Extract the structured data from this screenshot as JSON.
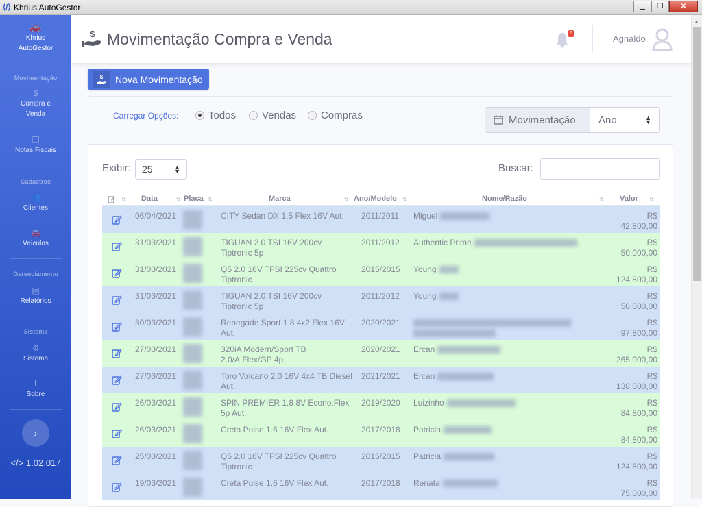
{
  "window": {
    "title": "Khrius AutoGestor",
    "minimize": "▁",
    "maximize": "❐",
    "close": "✕"
  },
  "sidebar": {
    "brand": "Khrius AutoGestor",
    "sections": {
      "movimentacao": "Movimentação",
      "cadastros": "Cadastros",
      "gerenciamento": "Gerenciamento",
      "sistema": "Sistema"
    },
    "items": {
      "compra_venda": "Compra e Venda",
      "notas": "Notas Fiscais",
      "clientes": "Clientes",
      "veiculos": "Veículos",
      "relatorios": "Relatórios",
      "sistema": "Sistema",
      "sobre": "Sobre"
    },
    "toggle": "›",
    "version": "1.02.017"
  },
  "topbar": {
    "title": "Movimentação Compra e Venda",
    "notifications": "6",
    "user": "Agnaldo"
  },
  "actions": {
    "new": "Nova Movimentação"
  },
  "filters": {
    "load_label": "Carregar Opções:",
    "options": [
      "Todos",
      "Vendas",
      "Compras"
    ],
    "selected": "Todos",
    "period_label": "Movimentação",
    "period_value": "Ano"
  },
  "table_controls": {
    "show_label": "Exibir:",
    "show_value": "25",
    "search_label": "Buscar:"
  },
  "table": {
    "headers": {
      "data": "Data",
      "placa": "Placa",
      "marca": "Marca",
      "ano": "Ano/Modelo",
      "nome": "Nome/Razão",
      "valor": "Valor"
    },
    "rows": [
      {
        "color": "blue",
        "data": "06/04/2021",
        "marca": "CITY Sedan DX 1.5 Flex 16V Aut.",
        "ano": "2011/2011",
        "nome": "Miguel",
        "valor": "R$ 42.800,00"
      },
      {
        "color": "green",
        "data": "31/03/2021",
        "marca": "TIGUAN 2.0 TSI 16V 200cv Tiptronic 5p",
        "ano": "2011/2012",
        "nome": "Authentic Prime",
        "valor": "R$ 50.000,00"
      },
      {
        "color": "green",
        "data": "31/03/2021",
        "marca": "Q5 2.0 16V TFSI 225cv Quattro Tiptronic",
        "ano": "2015/2015",
        "nome": "Young",
        "valor": "R$ 124.800,00"
      },
      {
        "color": "blue",
        "data": "31/03/2021",
        "marca": "TIGUAN 2.0 TSI 16V 200cv Tiptronic 5p",
        "ano": "2011/2012",
        "nome": "Young",
        "valor": "R$ 50.000,00"
      },
      {
        "color": "blue",
        "data": "30/03/2021",
        "marca": "Renegade Sport 1.8 4x2 Flex 16V Aut.",
        "ano": "2020/2021",
        "nome": "",
        "valor": "R$ 97.800,00"
      },
      {
        "color": "green",
        "data": "27/03/2021",
        "marca": "320iA Modern/Sport TB 2.0/A.Flex/GP 4p",
        "ano": "2020/2021",
        "nome": "Ercan",
        "valor": "R$ 265.000,00"
      },
      {
        "color": "blue",
        "data": "27/03/2021",
        "marca": "Toro Volcano 2.0 16V 4x4 TB Diesel Aut.",
        "ano": "2021/2021",
        "nome": "Ercan",
        "valor": "R$ 138.000,00"
      },
      {
        "color": "green",
        "data": "26/03/2021",
        "marca": "SPIN PREMIER 1.8 8V Econo.Flex 5p Aut.",
        "ano": "2019/2020",
        "nome": "Luizinho",
        "valor": "R$ 84.800,00"
      },
      {
        "color": "green",
        "data": "26/03/2021",
        "marca": "Creta Pulse 1.6 16V Flex Aut.",
        "ano": "2017/2018",
        "nome": "Patricia",
        "valor": "R$ 84.800,00"
      },
      {
        "color": "blue",
        "data": "25/03/2021",
        "marca": "Q5 2.0 16V TFSI 225cv Quattro Tiptronic",
        "ano": "2015/2015",
        "nome": "Patricia",
        "valor": "R$ 124.800,00"
      },
      {
        "color": "blue",
        "data": "19/03/2021",
        "marca": "Creta Pulse 1.6 16V Flex Aut.",
        "ano": "2017/2018",
        "nome": "Renata",
        "valor": "R$ 75.000,00"
      }
    ]
  }
}
